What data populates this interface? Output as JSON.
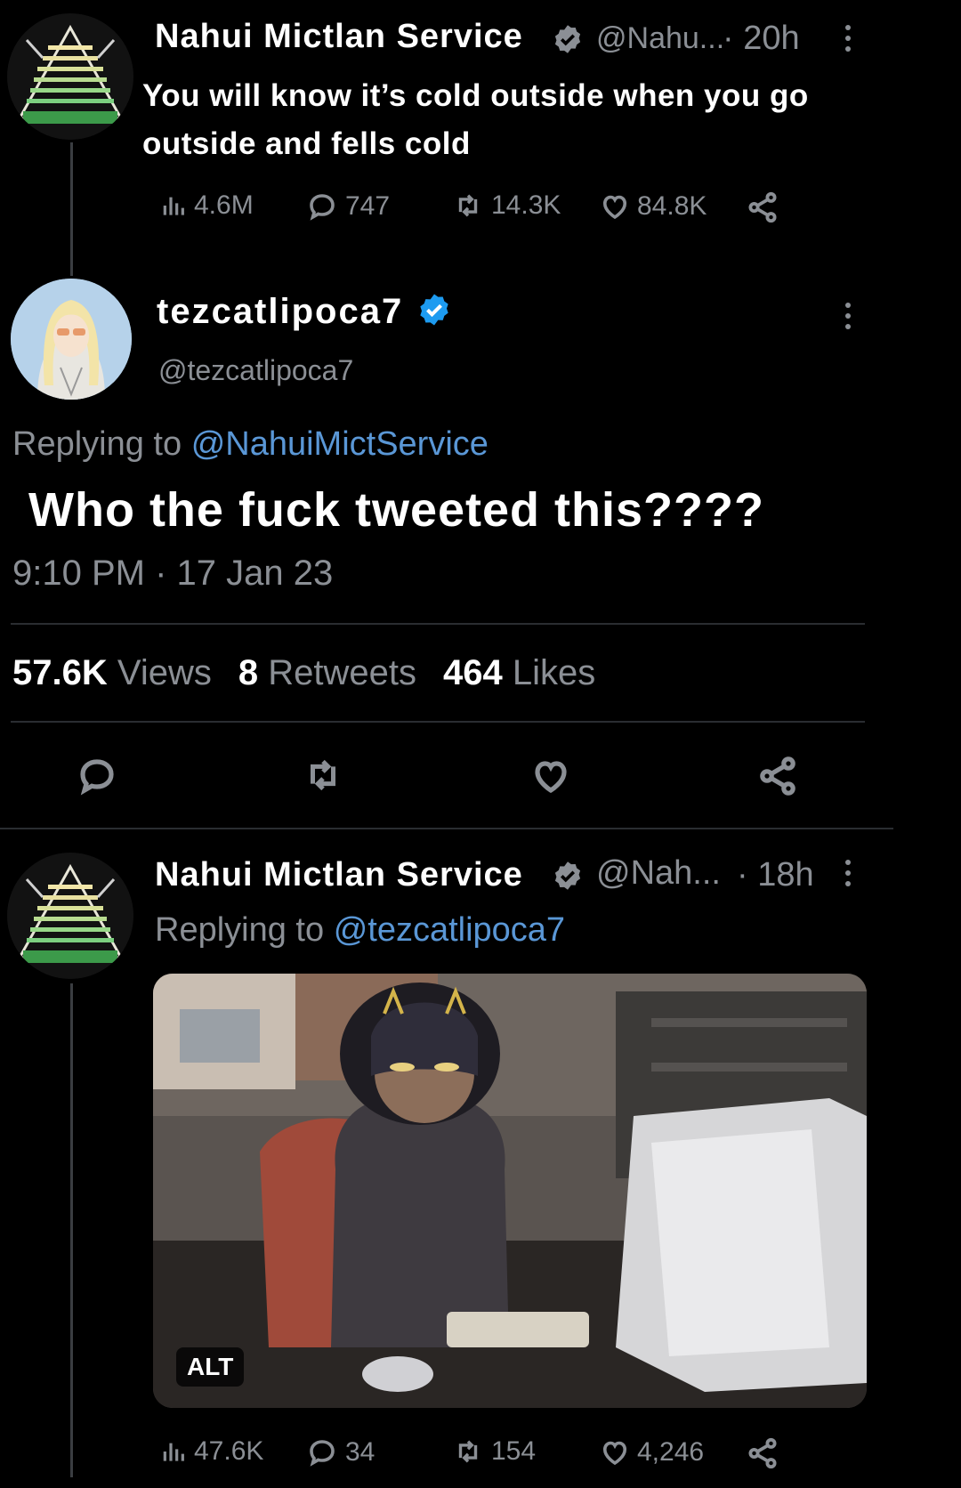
{
  "tweet1": {
    "display_name": "Nahui Mictlan Service",
    "handle": "@Nahu...",
    "time": "· 20h",
    "text_line1": "You will know it’s cold outside when you go",
    "text_line2": "outside and fells cold",
    "views": "4.6M",
    "replies": "747",
    "retweets": "14.3K",
    "likes": "84.8K"
  },
  "tweet2": {
    "display_name": "tezcatlipoca7",
    "handle": "@tezcatlipoca7",
    "replying_prefix": "Replying to",
    "replying_handle": "@NahuiMictService",
    "text": "Who the fuck tweeted this????",
    "timestamp": "9:10 PM · 17 Jan 23",
    "views_count": "57.6K",
    "views_label": "Views",
    "retweets_count": "8",
    "retweets_label": "Retweets",
    "likes_count": "464",
    "likes_label": "Likes"
  },
  "tweet3": {
    "display_name": "Nahui Mictlan Service",
    "handle": "@Nah...",
    "time": "· 18h",
    "replying_prefix": "Replying to",
    "replying_handle": "@tezcatlipoca7",
    "alt_badge": "ALT",
    "views": "47.6K",
    "replies": "34",
    "retweets": "154",
    "likes": "4,246"
  },
  "colors": {
    "background": "#000000",
    "secondary_text": "#8b8f95",
    "link_blue": "#5a97d6",
    "verified_blue": "#1d9bf0"
  }
}
